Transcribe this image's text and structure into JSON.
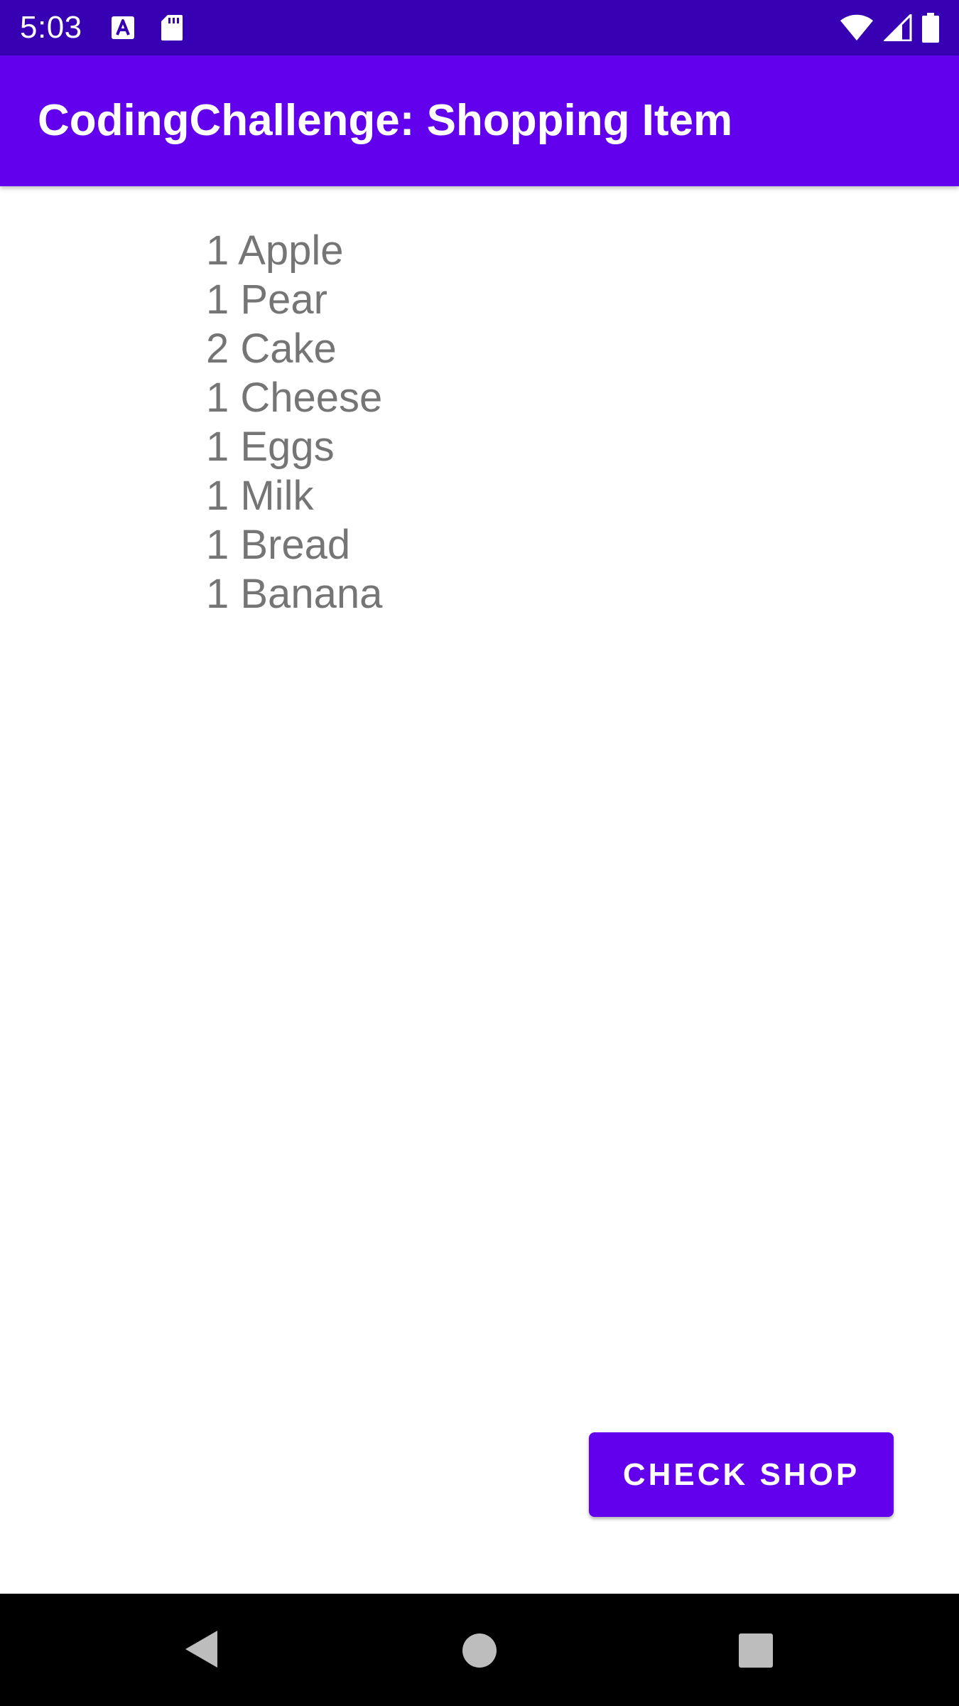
{
  "status_bar": {
    "time": "5:03",
    "left_icons": [
      "text-a-icon",
      "sd-card-icon"
    ],
    "right_icons": [
      "wifi-icon",
      "signal-icon",
      "battery-icon"
    ],
    "color": "#3700b3"
  },
  "app_bar": {
    "title": "CodingChallenge: Shopping Item",
    "color": "#6200ee"
  },
  "shopping_list": {
    "items": [
      "1 Apple",
      "1 Pear",
      "2 Cake",
      "1 Cheese",
      "1 Eggs",
      "1 Milk",
      "1 Bread",
      "1 Banana"
    ],
    "text_color": "#757575"
  },
  "actions": {
    "check_shop_label": "CHECK SHOP",
    "button_color": "#6200ee"
  },
  "nav_bar": {
    "buttons": [
      "back-icon",
      "home-icon",
      "recents-icon"
    ]
  }
}
